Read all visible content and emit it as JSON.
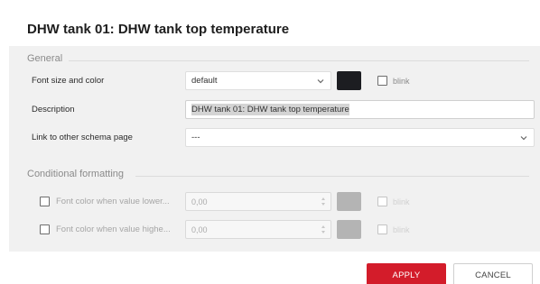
{
  "dialog": {
    "title": "DHW tank 01: DHW tank top temperature"
  },
  "general": {
    "legend": "General",
    "font_row": {
      "label": "Font size and color",
      "font_size": "default",
      "color": "#1c1d21",
      "blink_label": "blink",
      "blink_checked": false
    },
    "description_row": {
      "label": "Description",
      "value": "DHW tank 01: DHW tank top temperature"
    },
    "link_row": {
      "label": "Link to other schema page",
      "value": "---"
    }
  },
  "conditional": {
    "legend": "Conditional formatting",
    "lower": {
      "label": "Font color when value lower...",
      "value": "0,00",
      "color": "#b4b4b4",
      "blink_label": "blink",
      "checked": false
    },
    "higher": {
      "label": "Font color when value highe...",
      "value": "0,00",
      "color": "#b4b4b4",
      "blink_label": "blink",
      "checked": false
    }
  },
  "buttons": {
    "apply": "APPLY",
    "cancel": "CANCEL"
  }
}
